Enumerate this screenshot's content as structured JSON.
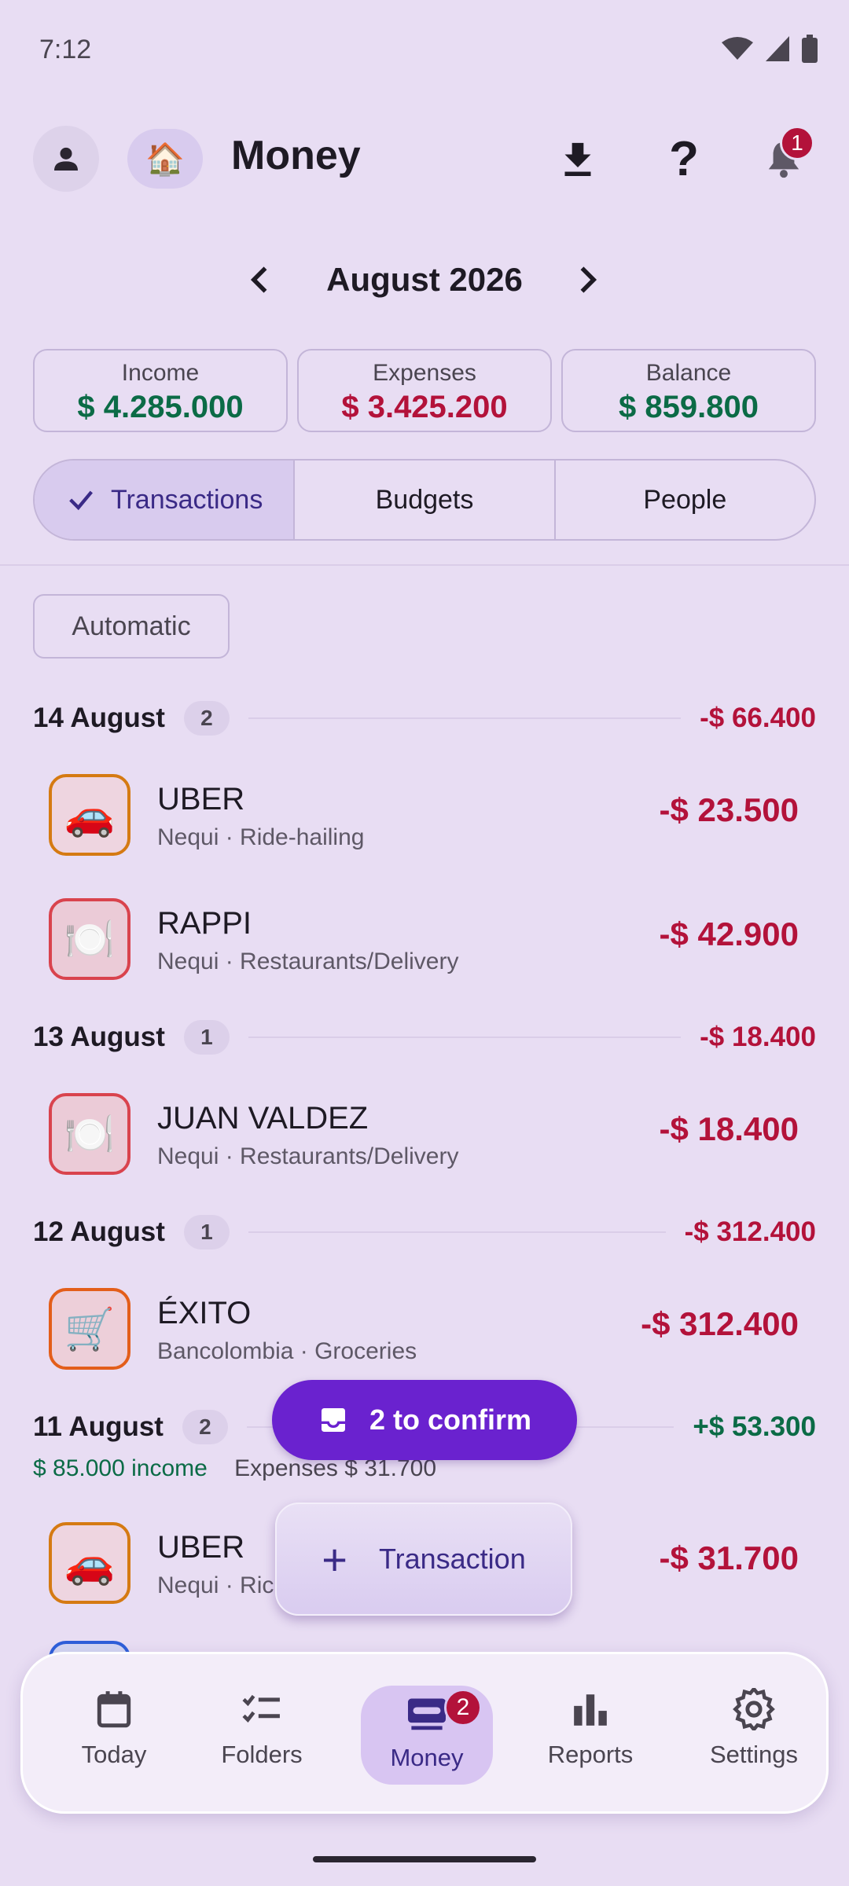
{
  "status_bar": {
    "time": "7:12"
  },
  "app_bar": {
    "home_emoji": "🏠",
    "title": "Money",
    "notification_count": "1",
    "help_glyph": "?"
  },
  "month": {
    "label": "August 2026"
  },
  "summary": {
    "income_label": "Income",
    "income_value": "$ 4.285.000",
    "expenses_label": "Expenses",
    "expenses_value": "$ 3.425.200",
    "balance_label": "Balance",
    "balance_value": "$ 859.800"
  },
  "tabs": {
    "transactions": "Transactions",
    "budgets": "Budgets",
    "people": "People"
  },
  "filter_chip": "Automatic",
  "groups": [
    {
      "date": "14 August",
      "count": "2",
      "total": "-$ 66.400"
    },
    {
      "date": "13 August",
      "count": "1",
      "total": "-$ 18.400"
    },
    {
      "date": "12 August",
      "count": "1",
      "total": "-$ 312.400"
    },
    {
      "date": "11 August",
      "count": "2",
      "total": "+$ 53.300",
      "income_note": "$ 85.000 income",
      "expense_note": "Expenses $ 31.700"
    }
  ],
  "transactions": [
    {
      "icon": "🚗",
      "name": "UBER",
      "sub": "Nequi · Ride-hailing",
      "amount": "-$ 23.500"
    },
    {
      "icon": "🍽️",
      "name": "RAPPI",
      "sub": "Nequi · Restaurants/Delivery",
      "amount": "-$ 42.900"
    },
    {
      "icon": "🍽️",
      "name": "JUAN VALDEZ",
      "sub": "Nequi · Restaurants/Delivery",
      "amount": "-$ 18.400"
    },
    {
      "icon": "🛒",
      "name": "ÉXITO",
      "sub": "Bancolombia · Groceries",
      "amount": "-$ 312.400"
    },
    {
      "icon": "🚗",
      "name": "UBER",
      "sub": "Nequi · Ric",
      "amount": "-$ 31.700"
    }
  ],
  "confirm_fab": {
    "label": "2 to confirm"
  },
  "add_fab": {
    "label": "Transaction",
    "plus": "+"
  },
  "bottom_nav": {
    "today": "Today",
    "folders": "Folders",
    "money": "Money",
    "money_badge": "2",
    "reports": "Reports",
    "settings": "Settings"
  },
  "colors": {
    "accent": "#6A22CF",
    "income": "#0B6B46",
    "expense": "#B3123A",
    "background": "#E8DDF3"
  }
}
